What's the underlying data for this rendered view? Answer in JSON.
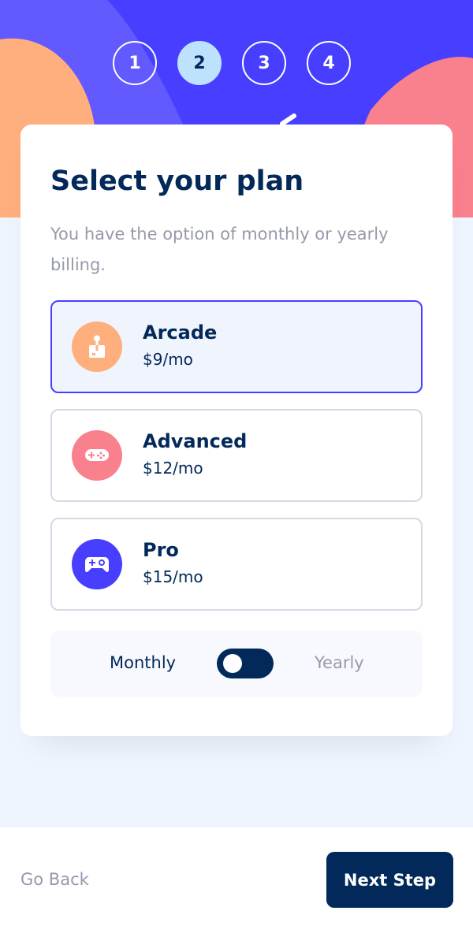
{
  "colors": {
    "accent": "#483eff",
    "primary_text": "#022959",
    "muted_text": "#9699aa",
    "page_bg": "#eff5ff",
    "arcade_icon_bg": "#ffaf7e",
    "advanced_icon_bg": "#f9818e",
    "pro_icon_bg": "#483eff",
    "active_step_bg": "#bee2fd"
  },
  "steps": [
    {
      "number": "1",
      "active": false
    },
    {
      "number": "2",
      "active": true
    },
    {
      "number": "3",
      "active": false
    },
    {
      "number": "4",
      "active": false
    }
  ],
  "card": {
    "title": "Select your plan",
    "description": "You have the option of monthly or yearly billing."
  },
  "plans": [
    {
      "name": "Arcade",
      "price": "$9/mo",
      "icon": "arcade-joystick-icon",
      "selected": true
    },
    {
      "name": "Advanced",
      "price": "$12/mo",
      "icon": "advanced-gamepad-icon",
      "selected": false
    },
    {
      "name": "Pro",
      "price": "$15/mo",
      "icon": "pro-controller-icon",
      "selected": false
    }
  ],
  "billing": {
    "monthly_label": "Monthly",
    "yearly_label": "Yearly",
    "selected": "monthly"
  },
  "footer": {
    "back_label": "Go Back",
    "next_label": "Next Step"
  }
}
